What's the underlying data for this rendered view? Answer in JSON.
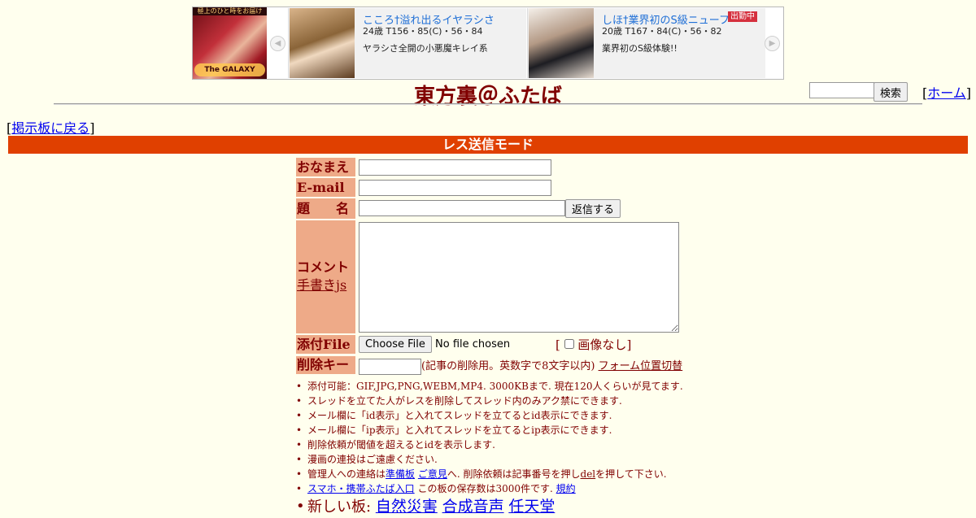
{
  "banner": {
    "left_tag": "極上のひと時をお届け",
    "left_logo": "The GALAXY",
    "prev_glyph": "◀",
    "next_glyph": "▶",
    "ads": [
      {
        "name": "こころ†溢れ出るイヤラシさ",
        "spec": "24歳 T156・85(C)・56・84",
        "desc": "ヤラシさ全開の小悪魔キレイ系"
      },
      {
        "name": "しほ†業界初のS級ニューフ",
        "badge": "出勤中",
        "spec": "20歳 T167・84(C)・56・82",
        "desc": "業界初のS級体験!!"
      }
    ]
  },
  "header": {
    "title": "東方裏＠ふたば",
    "search_button": "検索",
    "home_bracket_open": "[",
    "home_link": "ホーム",
    "home_bracket_close": "]"
  },
  "nav": {
    "back_bracket_open": "[",
    "back_link": "掲示板に戻る",
    "back_bracket_close": "]"
  },
  "mode_bar": "レス送信モード",
  "form": {
    "name_label": "おなまえ",
    "email_label": "E-mail",
    "subject_label": "題　　名",
    "submit_button": "返信する",
    "comment_label": "コメント",
    "handwrite_link": "手書きjs",
    "file_label": "添付File",
    "choose_file_button": "Choose File",
    "no_file_text": "No file chosen",
    "no_image_open": "[",
    "no_image_label": "画像なし",
    "no_image_close": "]",
    "delkey_label": "削除キー",
    "delkey_note": "(記事の削除用。英数字で8文字以内)",
    "form_pos_link": "フォーム位置切替"
  },
  "notes": {
    "n1": "添付可能：GIF,JPG,PNG,WEBM,MP4. 3000KBまで. 現在120人くらいが見てます.",
    "n2": "スレッドを立てた人がレスを削除してスレッド内のみアク禁にできます.",
    "n3": "メール欄に「id表示」と入れてスレッドを立てるとid表示にできます.",
    "n4": "メール欄に「ip表示」と入れてスレッドを立てるとip表示にできます.",
    "n5": "削除依頼が閾値を超えるとidを表示します.",
    "n6": "漫画の連投はご遠慮ください.",
    "n7_a": "管理人への連絡は",
    "n7_link1": "準備板",
    "n7_link2": "ご意見",
    "n7_b": "へ. 削除依頼は記事番号を押し",
    "n7_link3": "del",
    "n7_c": "を押して下さい.",
    "n8_link": "スマホ・携帯ふたば入口",
    "n8_text": "この板の保存数は3000件です.",
    "n8_link2": "規約",
    "n9_label": "新しい板:",
    "n9_boards": [
      "自然災害",
      "合成音声",
      "任天堂"
    ]
  }
}
